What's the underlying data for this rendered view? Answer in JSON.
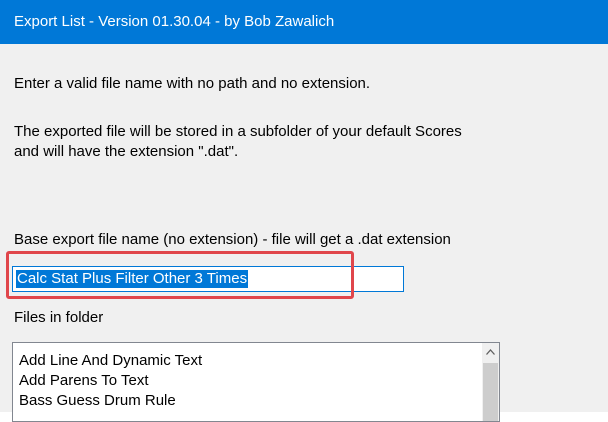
{
  "window": {
    "title": "Export List - Version 01.30.04 - by Bob Zawalich"
  },
  "instructions": {
    "line1": "Enter a valid file name with no path and no extension.",
    "line2": "The exported file will be stored  in a subfolder of your default Scores",
    "line3": "and will have the extension \".dat\"."
  },
  "base_name": {
    "label": "Base export file name (no extension) - file will get a .dat extension",
    "value": "Calc Stat Plus Filter Other 3 Times"
  },
  "files": {
    "label": "Files in folder",
    "items": [
      "Add Line And Dynamic Text",
      "Add Parens To Text",
      "Bass Guess Drum Rule"
    ]
  },
  "colors": {
    "titlebar": "#0078d7",
    "selection": "#0078d7",
    "highlight_box": "#e0464b"
  },
  "icons": {
    "scroll_up": "chevron-up-icon"
  }
}
